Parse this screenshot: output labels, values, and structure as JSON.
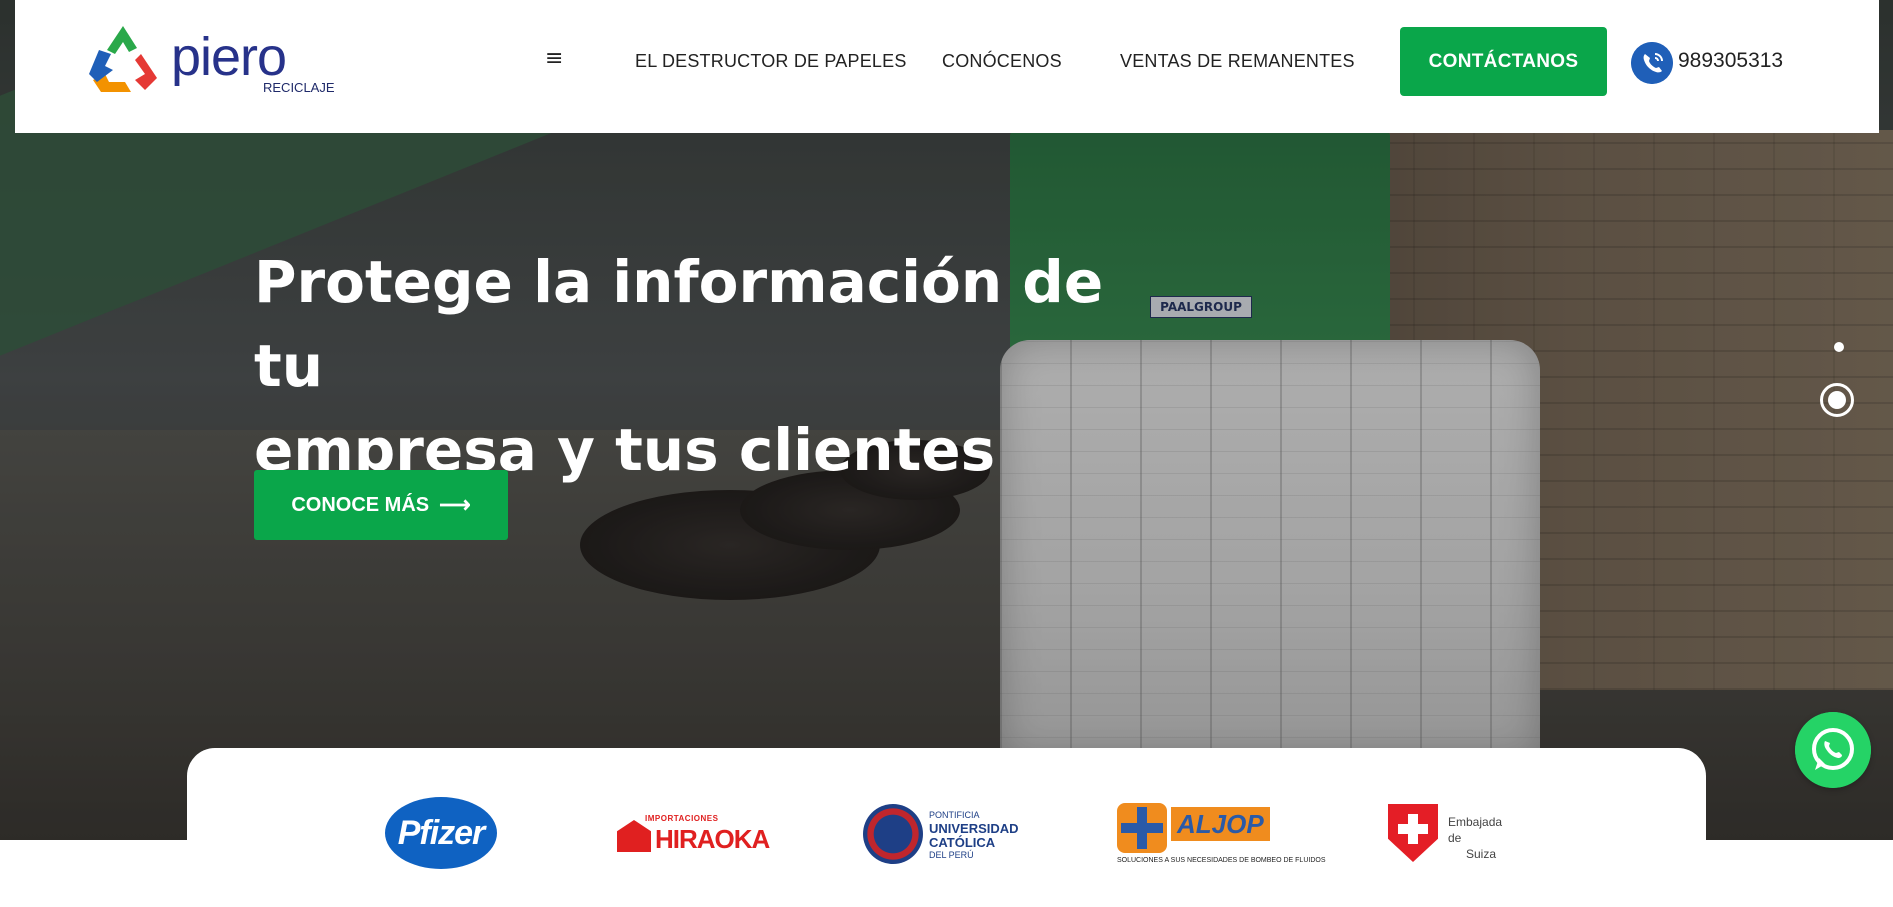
{
  "header": {
    "logo": {
      "name": "piero",
      "subtitle": "RECICLAJE"
    },
    "menu_icon": "hamburger-icon",
    "nav": [
      {
        "label": "EL DESTRUCTOR DE PAPELES"
      },
      {
        "label": "CONÓCENOS"
      },
      {
        "label": "VENTAS DE REMANENTES"
      }
    ],
    "cta_label": "CONTÁCTANOS",
    "phone_icon": "phone-icon",
    "phone": "989305313"
  },
  "hero": {
    "title_line1": "Protege la información de tu",
    "title_line2": "empresa y tus clientes",
    "button_label": "CONOCE MÁS",
    "button_arrow": "⟶",
    "machine_label": "PAALGROUP",
    "slides_total": 2,
    "active_slide": 2
  },
  "clients": {
    "pfizer": "Pfizer",
    "hiraoka_small": "IMPORTACIONES",
    "hiraoka_big": "HIRAOKA",
    "pucp_line1": "PONTIFICIA",
    "pucp_line2": "UNIVERSIDAD",
    "pucp_line3": "CATÓLICA",
    "pucp_line4": "DEL PERÚ",
    "aljop_name": "ALJOP",
    "aljop_tag": "SOLUCIONES A SUS NECESIDADES DE BOMBEO DE FLUIDOS",
    "suiza_line1": "Embajada de",
    "suiza_line2": "Suiza"
  },
  "colors": {
    "brand_green": "#0aa64a",
    "brand_navy": "#27328a",
    "phone_blue": "#1f5fb8",
    "whatsapp": "#25d366"
  },
  "whatsapp_icon": "whatsapp-icon"
}
